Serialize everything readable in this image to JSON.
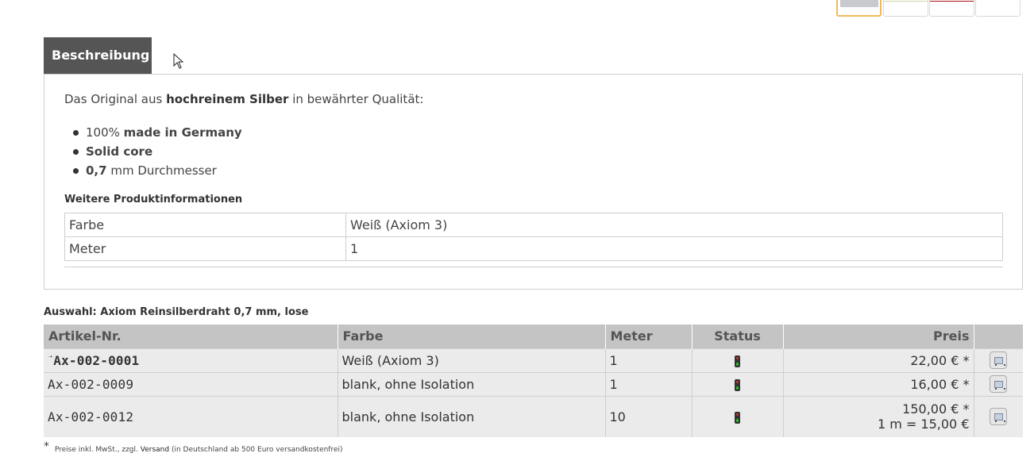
{
  "tab": {
    "label": "Beschreibung"
  },
  "description": {
    "intro_before": "Das Original aus ",
    "intro_bold": "hochreinem Silber",
    "intro_after": " in bewährter Qualität:",
    "bullets": [
      {
        "plain": "100% ",
        "bold": "made in Germany",
        "after": ""
      },
      {
        "plain": "",
        "bold": "Solid core",
        "after": ""
      },
      {
        "plain": "",
        "bold": "0,7",
        "after": " mm Durchmesser"
      }
    ]
  },
  "more_info": {
    "title": "Weitere Produktinformationen",
    "rows": [
      {
        "label": "Farbe",
        "value": "Weiß (Axiom 3)"
      },
      {
        "label": "Meter",
        "value": "1"
      }
    ]
  },
  "selection": {
    "prefix": "Auswahl:",
    "title": "Axiom Reinsilberdraht 0,7 mm, lose",
    "headers": {
      "article": "Artikel-Nr.",
      "color": "Farbe",
      "meter": "Meter",
      "status": "Status",
      "price": "Preis"
    },
    "rows": [
      {
        "article": "Ax-002-0001",
        "current": true,
        "color": "Weiß (Axiom 3)",
        "meter": "1",
        "price": "22,00 € *",
        "price_unit": ""
      },
      {
        "article": "Ax-002-0009",
        "current": false,
        "color": "blank, ohne Isolation",
        "meter": "1",
        "price": "16,00 € *",
        "price_unit": ""
      },
      {
        "article": "Ax-002-0012",
        "current": false,
        "color": "blank, ohne Isolation",
        "meter": "10",
        "price": "150,00 € *",
        "price_unit": "1 m = 15,00 €"
      }
    ],
    "status_icon": "traffic-light-icon",
    "action_icon": "add-to-cart-icon"
  },
  "footnote": {
    "star": "*",
    "text": "Preise inkl. MwSt., zzgl.",
    "link": "Versand",
    "after": "(in Deutschland ab 500 Euro versandkostenfrei)"
  }
}
